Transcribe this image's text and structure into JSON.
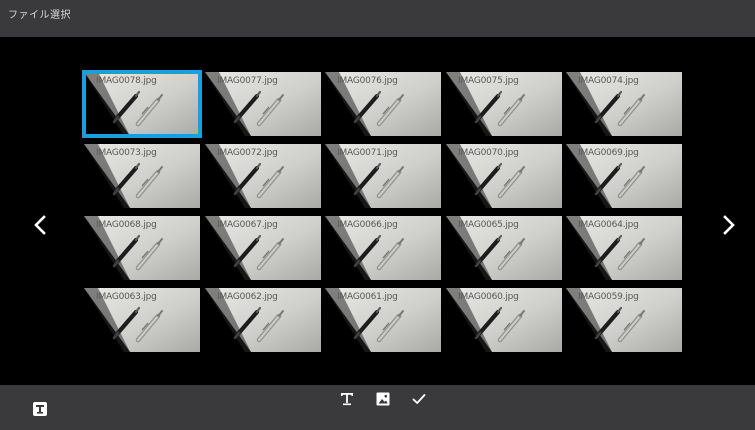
{
  "window": {
    "title": "ファイル選択"
  },
  "navigation": {
    "prev_icon": "chevron-left-icon",
    "next_icon": "chevron-right-icon"
  },
  "files": [
    {
      "name": "IMAG0078.jpg",
      "selected": true
    },
    {
      "name": "IMAG0077.jpg",
      "selected": false
    },
    {
      "name": "IMAG0076.jpg",
      "selected": false
    },
    {
      "name": "IMAG0075.jpg",
      "selected": false
    },
    {
      "name": "IMAG0074.jpg",
      "selected": false
    },
    {
      "name": "IMAG0073.jpg",
      "selected": false
    },
    {
      "name": "IMAG0072.jpg",
      "selected": false
    },
    {
      "name": "IMAG0071.jpg",
      "selected": false
    },
    {
      "name": "IMAG0070.jpg",
      "selected": false
    },
    {
      "name": "IMAG0069.jpg",
      "selected": false
    },
    {
      "name": "IMAG0068.jpg",
      "selected": false
    },
    {
      "name": "IMAG0067.jpg",
      "selected": false
    },
    {
      "name": "IMAG0066.jpg",
      "selected": false
    },
    {
      "name": "IMAG0065.jpg",
      "selected": false
    },
    {
      "name": "IMAG0064.jpg",
      "selected": false
    },
    {
      "name": "IMAG0063.jpg",
      "selected": false
    },
    {
      "name": "IMAG0062.jpg",
      "selected": false
    },
    {
      "name": "IMAG0061.jpg",
      "selected": false
    },
    {
      "name": "IMAG0060.jpg",
      "selected": false
    },
    {
      "name": "IMAG0059.jpg",
      "selected": false
    }
  ],
  "toolbar": {
    "left_icon": "text-box-icon",
    "items": [
      {
        "icon": "text-format-icon"
      },
      {
        "icon": "image-icon"
      },
      {
        "icon": "checkmark-icon"
      }
    ]
  },
  "colors": {
    "bar_background": "#3a3a3c",
    "selection": "#1a9fdc",
    "background": "#000000"
  }
}
